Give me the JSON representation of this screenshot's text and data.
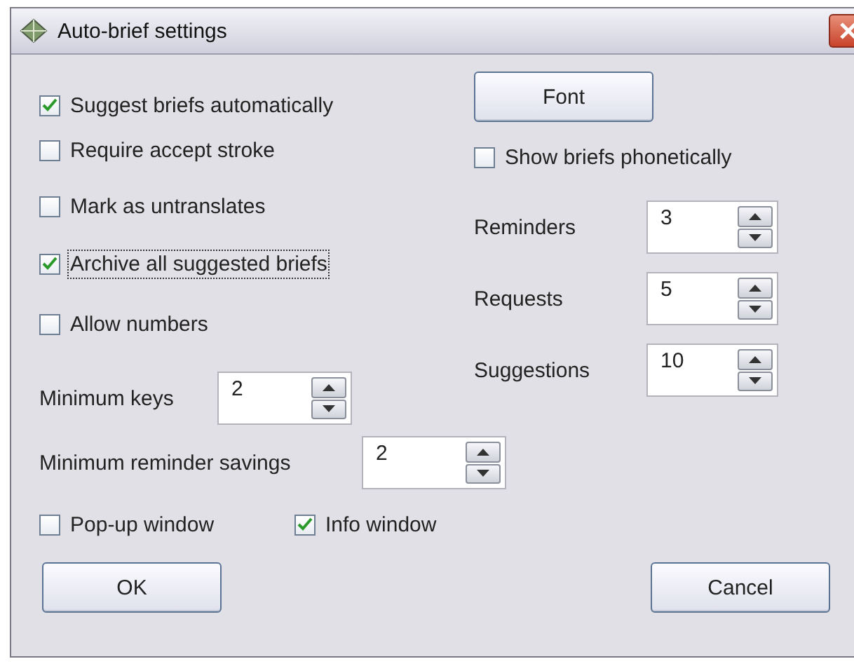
{
  "window": {
    "title": "Auto-brief settings"
  },
  "options": [
    {
      "label": "Suggest briefs automatically",
      "checked": true,
      "focused": false
    },
    {
      "label": "Require accept stroke",
      "checked": false,
      "focused": false
    },
    {
      "label": "Mark as untranslates",
      "checked": false,
      "focused": false
    },
    {
      "label": "Archive all suggested briefs",
      "checked": true,
      "focused": true
    },
    {
      "label": "Allow numbers",
      "checked": false,
      "focused": false
    }
  ],
  "minimum_keys": {
    "label": "Minimum keys",
    "value": "2"
  },
  "font_button": "Font",
  "phonetic": {
    "label": "Show briefs phonetically",
    "checked": false
  },
  "counts": [
    {
      "label": "Reminders",
      "value": "3"
    },
    {
      "label": "Requests",
      "value": "5"
    },
    {
      "label": "Suggestions",
      "value": "10"
    }
  ],
  "minimum_savings": {
    "label": "Minimum reminder savings",
    "value": "2"
  },
  "windows": [
    {
      "label": "Pop-up window",
      "checked": false
    },
    {
      "label": "Info window",
      "checked": true
    }
  ],
  "buttons": {
    "ok": "OK",
    "cancel": "Cancel"
  }
}
